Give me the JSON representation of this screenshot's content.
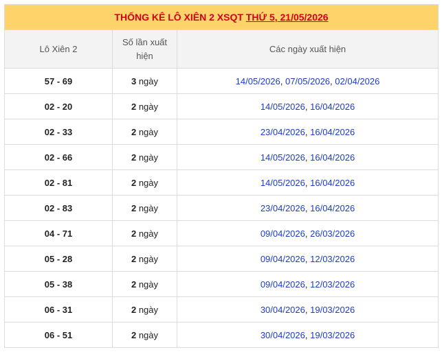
{
  "title": {
    "prefix": "THỐNG KÊ LÔ XIÊN 2 XSQT",
    "date_link": "THỨ 5, 21/05/2026"
  },
  "headers": {
    "col1": "Lô Xiên 2",
    "col2": "Số lần xuất hiện",
    "col3": "Các ngày xuất hiện"
  },
  "rows": [
    {
      "pair": "57 - 69",
      "count": "3",
      "unit": "ngày",
      "dates": [
        "14/05/2026",
        "07/05/2026",
        "02/04/2026"
      ]
    },
    {
      "pair": "02 - 20",
      "count": "2",
      "unit": "ngày",
      "dates": [
        "14/05/2026",
        "16/04/2026"
      ]
    },
    {
      "pair": "02 - 33",
      "count": "2",
      "unit": "ngày",
      "dates": [
        "23/04/2026",
        "16/04/2026"
      ]
    },
    {
      "pair": "02 - 66",
      "count": "2",
      "unit": "ngày",
      "dates": [
        "14/05/2026",
        "16/04/2026"
      ]
    },
    {
      "pair": "02 - 81",
      "count": "2",
      "unit": "ngày",
      "dates": [
        "14/05/2026",
        "16/04/2026"
      ]
    },
    {
      "pair": "02 - 83",
      "count": "2",
      "unit": "ngày",
      "dates": [
        "23/04/2026",
        "16/04/2026"
      ]
    },
    {
      "pair": "04 - 71",
      "count": "2",
      "unit": "ngày",
      "dates": [
        "09/04/2026",
        "26/03/2026"
      ]
    },
    {
      "pair": "05 - 28",
      "count": "2",
      "unit": "ngày",
      "dates": [
        "09/04/2026",
        "12/03/2026"
      ]
    },
    {
      "pair": "05 - 38",
      "count": "2",
      "unit": "ngày",
      "dates": [
        "09/04/2026",
        "12/03/2026"
      ]
    },
    {
      "pair": "06 - 31",
      "count": "2",
      "unit": "ngày",
      "dates": [
        "30/04/2026",
        "19/03/2026"
      ]
    },
    {
      "pair": "06 - 51",
      "count": "2",
      "unit": "ngày",
      "dates": [
        "30/04/2026",
        "19/03/2026"
      ]
    }
  ],
  "colors": {
    "title_bg": "#fdd36a",
    "title_text": "#d0021b",
    "header_bg": "#f3f3f3",
    "date_link": "#1a3cc4"
  }
}
